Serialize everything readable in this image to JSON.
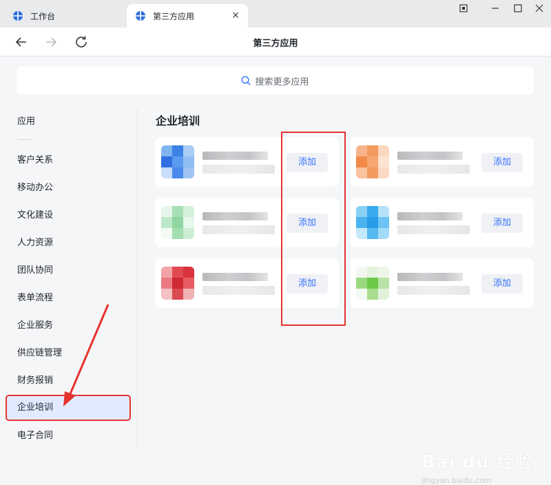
{
  "tabs": [
    {
      "label": "工作台",
      "icon": "app-globe-icon"
    },
    {
      "label": "第三方应用",
      "icon": "app-globe-icon",
      "close": "✕"
    }
  ],
  "nav": {
    "title": "第三方应用"
  },
  "search": {
    "placeholder": "搜索更多应用"
  },
  "sidebar": {
    "header": "应用",
    "items": [
      {
        "label": "客户关系"
      },
      {
        "label": "移动办公"
      },
      {
        "label": "文化建设"
      },
      {
        "label": "人力资源"
      },
      {
        "label": "团队协同"
      },
      {
        "label": "表单流程"
      },
      {
        "label": "企业服务"
      },
      {
        "label": "供应链管理"
      },
      {
        "label": "财务报销"
      },
      {
        "label": "企业培训",
        "active": true
      },
      {
        "label": "电子合同"
      }
    ]
  },
  "section": {
    "title": "企业培训"
  },
  "cards": [
    {
      "add_label": "添加",
      "icon_colors": [
        "#7fb3ee",
        "#3b82e6",
        "#a9cdf5",
        "#2f6fe0",
        "#5b9bef",
        "#8ebef3",
        "#c7dcf8",
        "#4a8aec",
        "#9fc4f4"
      ]
    },
    {
      "add_label": "添加",
      "icon_colors": [
        "#f7b48a",
        "#f39a5e",
        "#fbd8c1",
        "#f28a48",
        "#f6a66e",
        "#fde3d1",
        "#fac29e",
        "#f49b62",
        "#fcd9c3"
      ]
    },
    {
      "add_label": "添加",
      "icon_colors": [
        "#e6f6ea",
        "#a8e0b5",
        "#d3f0da",
        "#bde8c7",
        "#8fd6a0",
        "#e9f8ed",
        "#f2fbf4",
        "#a3deb1",
        "#cdeed5"
      ]
    },
    {
      "add_label": "添加",
      "icon_colors": [
        "#8ad2f5",
        "#3aa9ee",
        "#b5e2f9",
        "#4bb3f0",
        "#2a9be8",
        "#6bc4f3",
        "#c5e9fa",
        "#56b9f1",
        "#a2dbf7"
      ]
    },
    {
      "add_label": "添加",
      "icon_colors": [
        "#f1a3a6",
        "#e24a52",
        "#d8333c",
        "#ea7a80",
        "#cf2a33",
        "#e85c63",
        "#f3c1c3",
        "#db4a51",
        "#efb1b4"
      ]
    },
    {
      "add_label": "添加",
      "icon_colors": [
        "#f3f7f0",
        "#e6f3df",
        "#eef6ea",
        "#9bd77f",
        "#6cc94a",
        "#b9e3a6",
        "#f5f9f3",
        "#a8dd8f",
        "#e2f1da"
      ]
    }
  ],
  "watermark": {
    "brand": "Bai du 经验",
    "url": "jingyan.baidu.com"
  },
  "colors": {
    "accent": "#3370ff",
    "highlight": "#e5322d",
    "active_bg": "#e1eaff"
  }
}
